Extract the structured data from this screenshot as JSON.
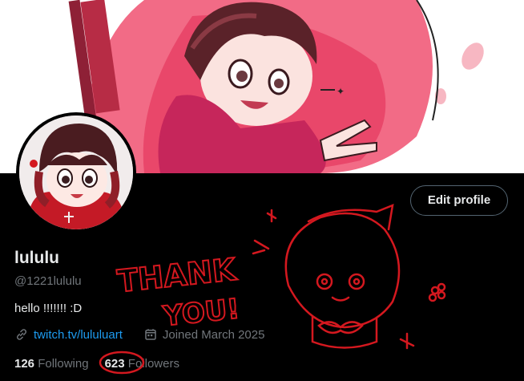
{
  "profile": {
    "display_name": "lululu",
    "handle": "@1221lululu",
    "bio": "hello !!!!!!! :D",
    "link": "twitch.tv/lululuart",
    "joined": "Joined March 2025",
    "following_count": "126",
    "following_label": "Following",
    "followers_count": "623",
    "followers_label": "Followers"
  },
  "actions": {
    "edit_profile": "Edit profile"
  },
  "doodle": {
    "thank": "THANK",
    "you": "YOU!"
  },
  "colors": {
    "link": "#1d9bf0",
    "muted": "#71767b",
    "doodle": "#d4181f",
    "background": "#000000"
  },
  "icons": [
    "link-icon",
    "calendar-icon"
  ]
}
